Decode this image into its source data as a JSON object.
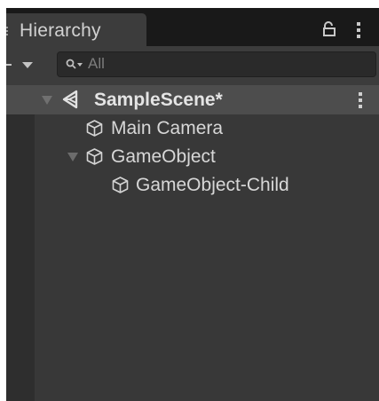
{
  "window": {
    "tab_title": "Hierarchy",
    "lock_icon": "lock-icon",
    "menu_icon": "kebab-menu-icon"
  },
  "toolbar": {
    "create_icon": "plus-dropdown-icon",
    "search": {
      "icon": "search-filter-icon",
      "placeholder": "All",
      "value": ""
    }
  },
  "hierarchy": {
    "scene": {
      "label": "SampleScene*",
      "icon": "unity-scene-icon",
      "expanded": true,
      "menu_icon": "kebab-menu-icon"
    },
    "items": [
      {
        "label": "Main Camera",
        "icon": "gameobject-cube-icon",
        "depth": 1,
        "has_children": false
      },
      {
        "label": "GameObject",
        "icon": "gameobject-cube-icon",
        "depth": 1,
        "has_children": true,
        "expanded": true
      },
      {
        "label": "GameObject-Child",
        "icon": "gameobject-cube-icon",
        "depth": 2,
        "has_children": false
      }
    ]
  },
  "colors": {
    "panel_bg": "#383838",
    "tab_strip_bg": "#191919",
    "tab_bg": "#3c3c3c",
    "selected_row_bg": "#4d4d4d",
    "text": "#d7d7d7"
  }
}
